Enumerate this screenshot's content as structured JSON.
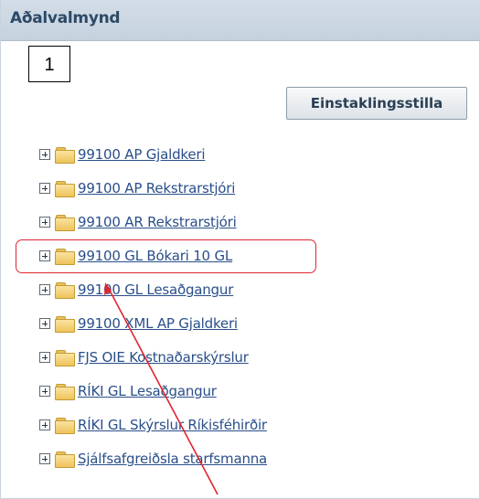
{
  "header": {
    "title": "Aðalvalmynd"
  },
  "annotation": {
    "step_number": "1"
  },
  "toolbar": {
    "personalize_label": "Einstaklingsstilla"
  },
  "tree": {
    "items": [
      {
        "label": "99100 AP Gjaldkeri"
      },
      {
        "label": "99100 AP Rekstrarstjóri"
      },
      {
        "label": "99100 AR Rekstrarstjóri"
      },
      {
        "label": "99100 GL Bókari 10 GL"
      },
      {
        "label": "99100 GL Lesaðgangur"
      },
      {
        "label": "99100 XML AP Gjaldkeri"
      },
      {
        "label": "FJS OIE Kostnaðarskýrslur"
      },
      {
        "label": "RÍKI GL Lesaðgangur"
      },
      {
        "label": "RÍKI GL Skýrslur Ríkisféhirðir"
      },
      {
        "label": "Sjálfsafgreiðsla starfsmanna"
      }
    ],
    "highlighted_index": 3
  },
  "colors": {
    "header_bg": "#c9d5e1",
    "header_text": "#2d4a66",
    "link": "#2a4f8a",
    "highlight": "#e0252f"
  }
}
